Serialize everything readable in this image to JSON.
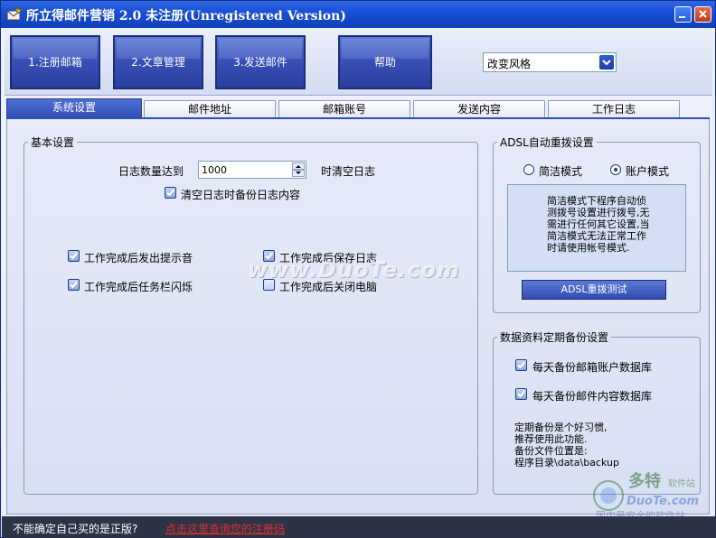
{
  "window": {
    "title": "所立得邮件营销 2.0 未注册(Unregistered Version)"
  },
  "toolbar": {
    "buttons": [
      "1.注册邮箱",
      "2.文章管理",
      "3.发送邮件",
      "帮助"
    ],
    "style_select": {
      "value": "改变风格"
    }
  },
  "tabs": [
    "系统设置",
    "邮件地址",
    "邮箱账号",
    "发送内容",
    "工作日志"
  ],
  "basic": {
    "legend": "基本设置",
    "log_limit_label": "日志数量达到",
    "log_limit_value": "1000",
    "log_limit_suffix": "时清空日志",
    "backup_on_clear": {
      "label": "清空日志时备份日志内容",
      "checked": true
    },
    "options": [
      {
        "label": "工作完成后发出提示音",
        "checked": true
      },
      {
        "label": "工作完成后保存日志",
        "checked": true
      },
      {
        "label": "工作完成后任务栏闪烁",
        "checked": true
      },
      {
        "label": "工作完成后关闭电脑",
        "checked": false
      }
    ]
  },
  "adsl": {
    "legend": "ADSL自动重拨设置",
    "modes": [
      {
        "label": "简洁模式",
        "selected": false
      },
      {
        "label": "账户模式",
        "selected": true
      }
    ],
    "info_text": "简洁模式下程序自动侦测拨号设置进行拨号,无需进行任何其它设置,当简洁模式无法正常工作时请使用帐号模式.",
    "test_button": "ADSL重拨测试"
  },
  "backup": {
    "legend": "数据资料定期备份设置",
    "options": [
      {
        "label": "每天备份邮箱账户数据库",
        "checked": true
      },
      {
        "label": "每天备份邮件内容数据库",
        "checked": true
      }
    ],
    "note_lines": [
      "定期备份是个好习惯,",
      "推荐使用此功能.",
      "备份文件位置是:",
      "程序目录\\data\\backup"
    ]
  },
  "watermark": "www.DuoTe.com",
  "status": {
    "question": "不能确定自己买的是正版?",
    "link": "点击这里查询您的注册码"
  },
  "colors": {
    "titlebar": "#1a4fd6",
    "button": "#3850b8",
    "status_bg": "#2c3347",
    "link": "#e03030"
  }
}
